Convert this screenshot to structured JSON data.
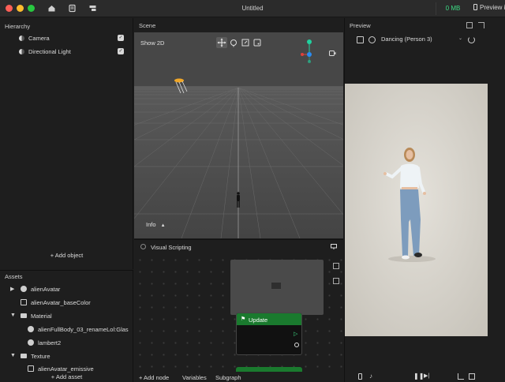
{
  "window": {
    "title": "Untitled",
    "memory": "0 MB",
    "preview_button": "Preview in"
  },
  "hierarchy": {
    "title": "Hierarchy",
    "items": [
      {
        "label": "Camera",
        "enabled": true
      },
      {
        "label": "Directional Light",
        "enabled": true
      }
    ],
    "add_button": "+ Add object"
  },
  "assets": {
    "title": "Assets",
    "items": [
      {
        "label": "alienAvatar",
        "icon": "package-icon",
        "expandable": true,
        "expanded": false
      },
      {
        "label": "alienAvatar_baseColor",
        "icon": "texture-icon",
        "expandable": false
      },
      {
        "label": "Material",
        "icon": "folder-icon",
        "expandable": true,
        "expanded": true
      },
      {
        "label": "alienFullBody_03_renameLol:Glas",
        "icon": "material-icon",
        "expandable": false
      },
      {
        "label": "lambert2",
        "icon": "material-icon",
        "expandable": false
      },
      {
        "label": "Texture",
        "icon": "folder-icon",
        "expandable": true,
        "expanded": true
      },
      {
        "label": "alienAvatar_emissive",
        "icon": "texture-icon",
        "expandable": false
      }
    ],
    "add_button": "+ Add asset"
  },
  "scene": {
    "title": "Scene",
    "show2d": "Show 2D",
    "info": "Info",
    "tools": [
      "move-tool-icon",
      "rotate-tool-icon",
      "scale-tool-icon",
      "rect-tool-icon"
    ]
  },
  "visual_scripting": {
    "title": "Visual Scripting",
    "node_title": "Update",
    "footer": {
      "add_node": "+ Add node",
      "variables": "Variables",
      "subgraph": "Subgraph"
    }
  },
  "preview": {
    "title": "Preview",
    "selected_effect": "Dancing (Person 3)"
  },
  "colors": {
    "accent_green": "#3ddc84",
    "node_header": "#1a7a2e",
    "gizmo_y": "#21d19f",
    "gizmo_x": "#e0403a",
    "gizmo_z": "#2a8bf2"
  }
}
